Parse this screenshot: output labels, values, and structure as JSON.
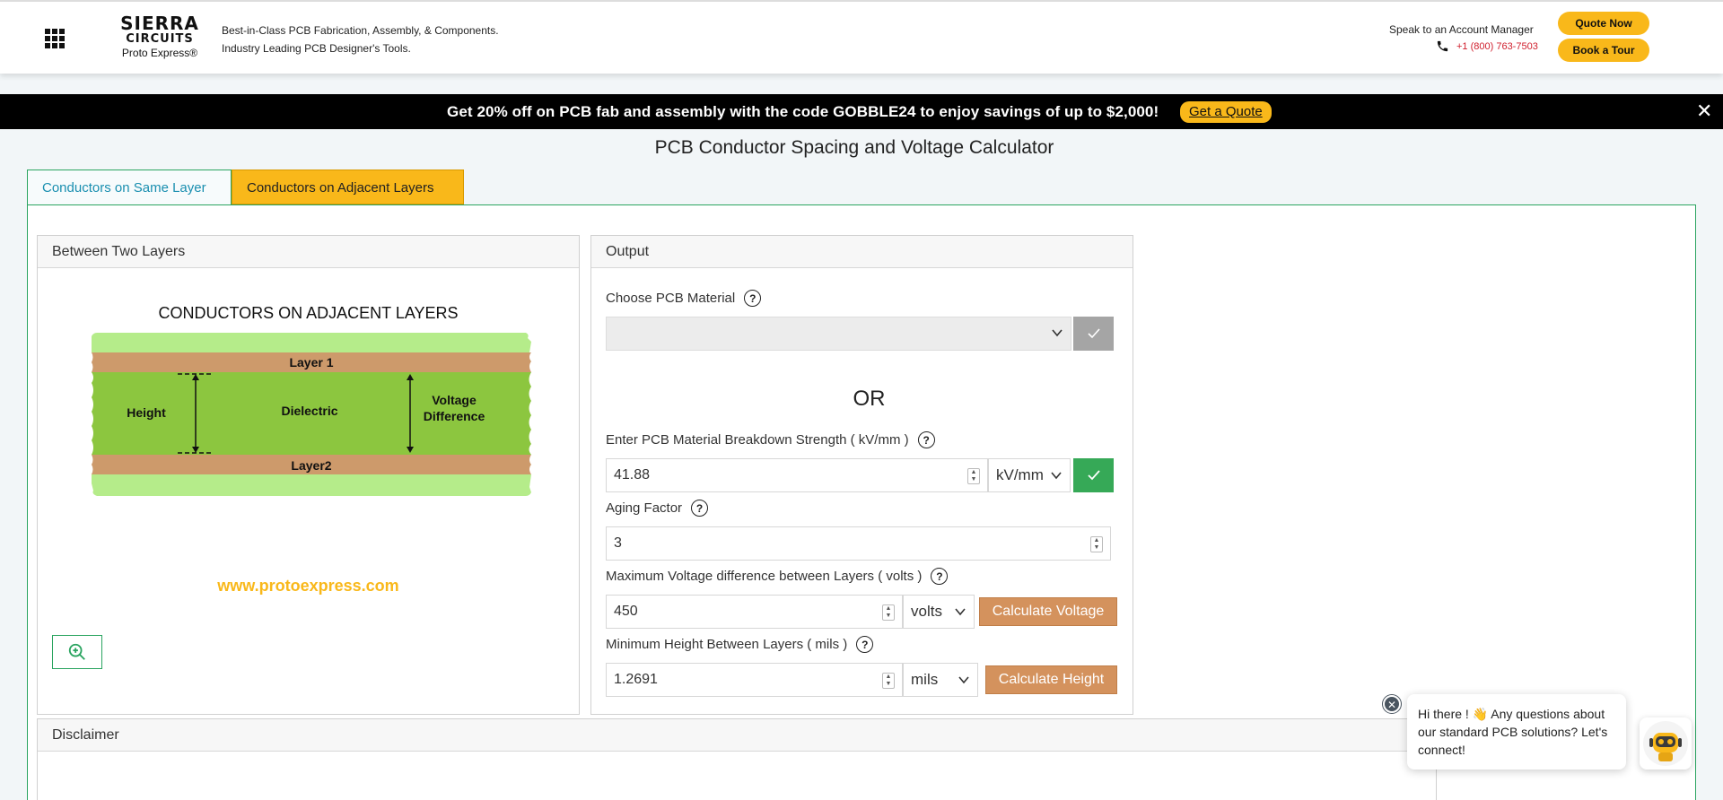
{
  "header": {
    "logo_line1": "SIERRA",
    "logo_line2": "CIRCUITS",
    "logo_line3": "Proto Express®",
    "tagline_line1": "Best-in-Class PCB Fabrication, Assembly, & Components.",
    "tagline_line2": "Industry Leading PCB Designer's Tools.",
    "speak_label": "Speak to an Account Manager",
    "phone": "+1 (800) 763-7503",
    "quote_button": "Quote Now",
    "tour_button": "Book a Tour"
  },
  "promo": {
    "text": "Get 20% off on PCB fab and assembly with the code GOBBLE24 to enjoy savings of up to $2,000!",
    "link": "Get a Quote",
    "close": "✕"
  },
  "page_title": "PCB Conductor Spacing and Voltage Calculator",
  "tabs": [
    {
      "label": "Conductors on Same Layer",
      "active": false
    },
    {
      "label": "Conductors on Adjacent Layers",
      "active": true
    }
  ],
  "left_panel": {
    "header": "Between Two Layers",
    "diagram_title": "CONDUCTORS ON ADJACENT LAYERS",
    "layer1": "Layer 1",
    "layer2": "Layer2",
    "height_label": "Height",
    "dielectric_label": "Dielectric",
    "voltage_label_1": "Voltage",
    "voltage_label_2": "Difference",
    "url": "www.protoexpress.com"
  },
  "output": {
    "header": "Output",
    "material_label": "Choose PCB Material",
    "material_value": "",
    "or_text": "OR",
    "breakdown_label": "Enter PCB Material Breakdown Strength ( kV/mm )",
    "breakdown_value": "41.88",
    "breakdown_unit": "kV/mm",
    "aging_label": "Aging Factor",
    "aging_value": "3",
    "voltage_label": "Maximum Voltage difference between Layers ( volts )",
    "voltage_value": "450",
    "voltage_unit": "volts",
    "calc_voltage": "Calculate Voltage",
    "height_label": "Minimum Height Between Layers ( mils )",
    "height_value": "1.2691",
    "height_unit": "mils",
    "calc_height": "Calculate Height",
    "help_glyph": "?"
  },
  "disclaimer": {
    "header": "Disclaimer"
  },
  "chat": {
    "message": "Hi there ! 👋 Any questions about our standard PCB solutions? Let's connect!",
    "close": "✕"
  },
  "colors": {
    "accent_yellow": "#f9b81a",
    "tab_green": "#2aa460",
    "check_green": "#36a957",
    "calc_button": "#d4925d",
    "dielectric_green": "#8cc63f",
    "layer_copper": "#cd9a6b",
    "promo_bg": "#000000"
  }
}
